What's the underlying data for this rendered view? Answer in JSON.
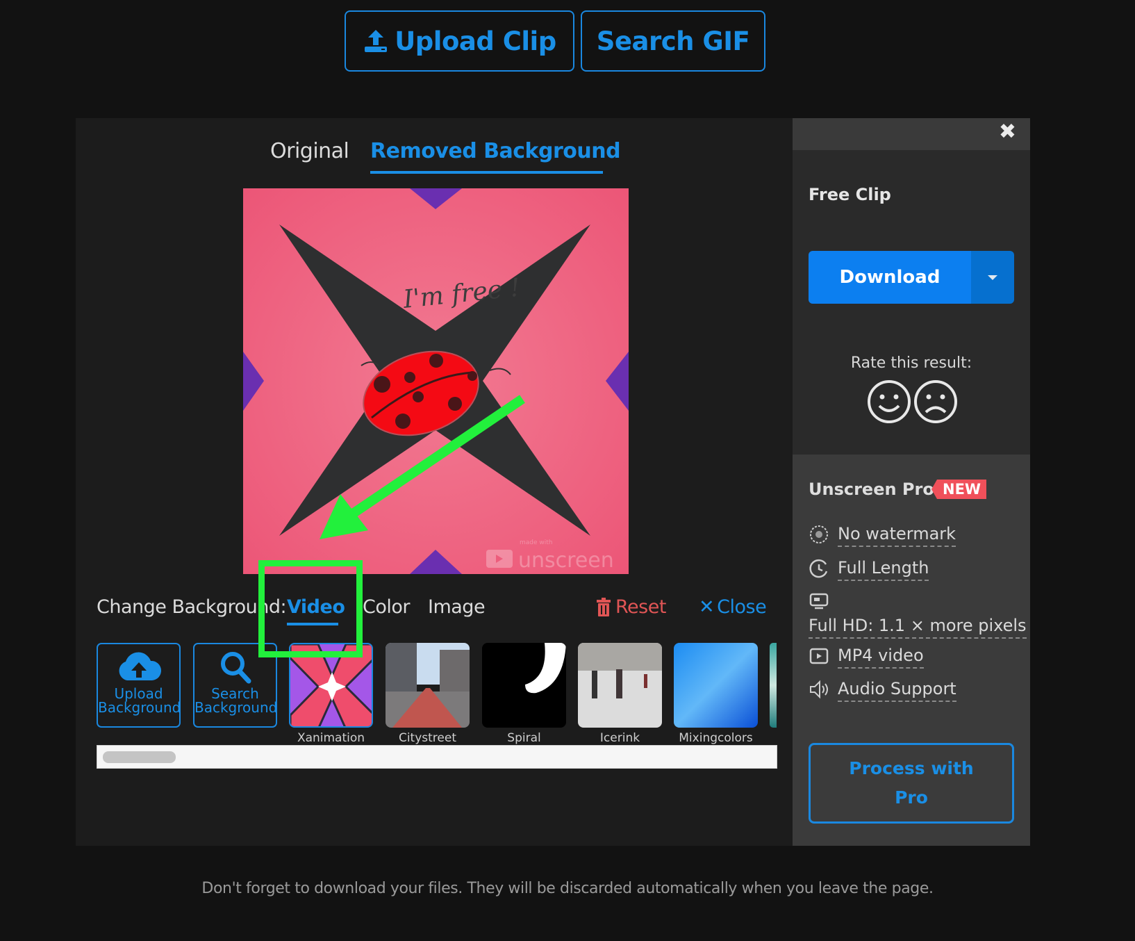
{
  "header": {
    "upload_clip": {
      "label": "Upload Clip",
      "icon": "upload-icon"
    },
    "search_gif": {
      "label": "Search GIF"
    }
  },
  "preview_tabs": [
    {
      "label": "Original",
      "active": false
    },
    {
      "label": "Removed Background",
      "active": true
    }
  ],
  "preview": {
    "caption_text": "I'm free !",
    "watermark_small": "made with",
    "watermark_brand": "unscreen"
  },
  "change_background": {
    "label": "Change Background:",
    "options": [
      {
        "label": "Video",
        "active": true
      },
      {
        "label": "Color",
        "active": false
      },
      {
        "label": "Image",
        "active": false
      }
    ],
    "reset_label": "Reset",
    "close_label": "Close",
    "tools": [
      {
        "label_line1": "Upload",
        "label_line2": "Background",
        "icon": "cloud-upload-icon"
      },
      {
        "label_line1": "Search",
        "label_line2": "Background",
        "icon": "search-icon"
      }
    ],
    "thumbnails": [
      {
        "label": "Xanimation",
        "selected": true
      },
      {
        "label": "Citystreet",
        "selected": false
      },
      {
        "label": "Spiral",
        "selected": false
      },
      {
        "label": "Icerink",
        "selected": false
      },
      {
        "label": "Mixingcolors",
        "selected": false
      }
    ]
  },
  "sidebar": {
    "close_icon": "close-icon",
    "free_clip_title": "Free Clip",
    "download_label": "Download",
    "rate_label": "Rate this result:",
    "pro_title": "Unscreen Pro",
    "pro_badge": "NEW",
    "features": [
      {
        "label": "No watermark",
        "icon": "watermark-icon"
      },
      {
        "label": "Full Length",
        "icon": "clock-icon"
      },
      {
        "label": "Full HD: 1.1 × more pixels",
        "icon": "monitor-icon"
      },
      {
        "label": "MP4 video",
        "icon": "play-icon"
      },
      {
        "label": "Audio Support",
        "icon": "speaker-icon"
      }
    ],
    "process_label_line1": "Process with",
    "process_label_line2": "Pro"
  },
  "footer": {
    "notice": "Don't forget to download your files. They will be discarded automatically when you leave the page."
  },
  "colors": {
    "accent": "#1a8fe6",
    "danger": "#e05555",
    "badge": "#f0505a",
    "annotation": "#22f03c"
  }
}
